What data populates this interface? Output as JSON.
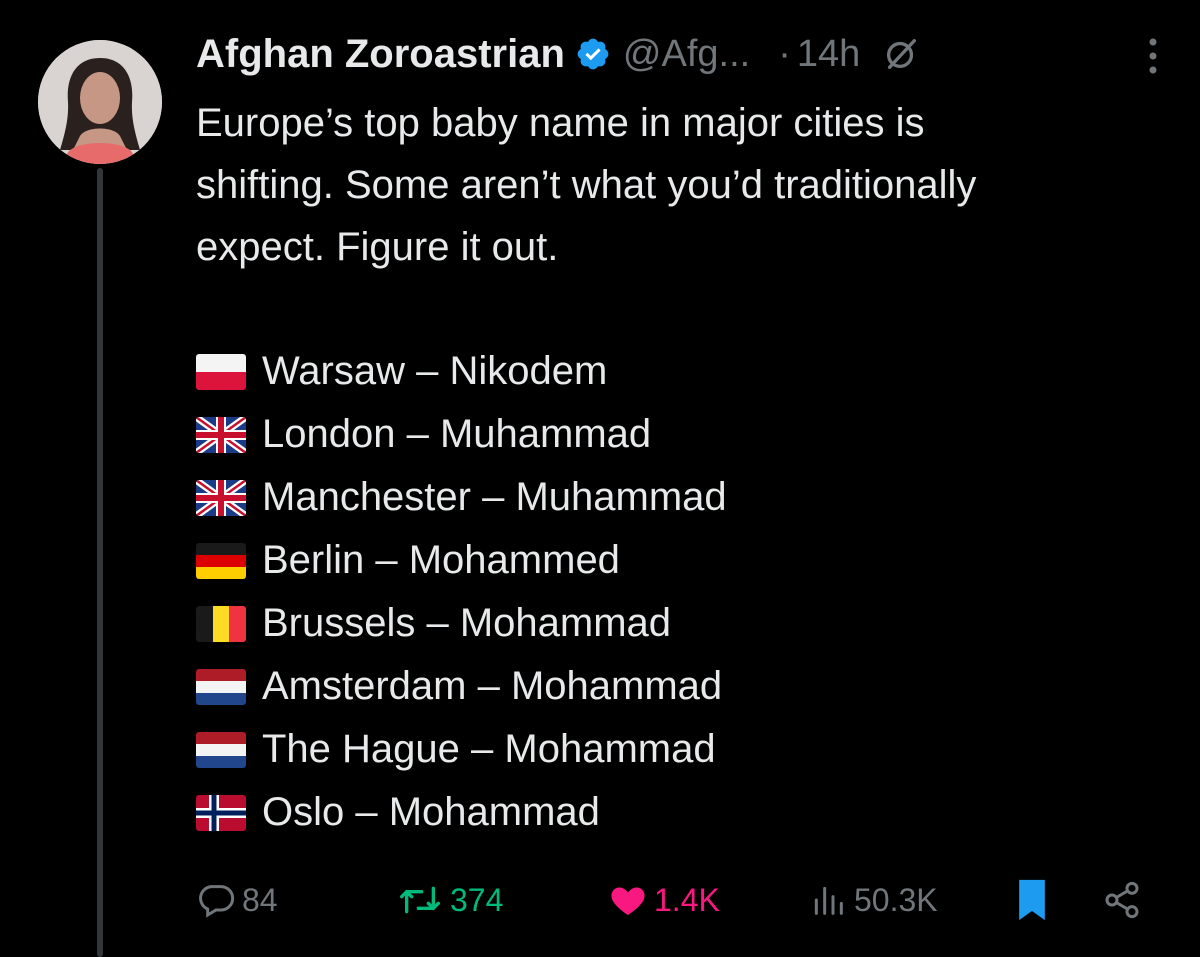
{
  "tweet": {
    "author_name": "Afghan Zoroastrian",
    "handle": "@Afg...",
    "separator": "·",
    "time": "14h",
    "text_lines": [
      "Europe’s top baby name in major cities is",
      "shifting. Some aren’t what you’d traditionally",
      "expect. Figure it out."
    ],
    "list": [
      {
        "flag": "poland-flag",
        "text": "Warsaw – Nikodem"
      },
      {
        "flag": "uk-flag",
        "text": "London – Muhammad"
      },
      {
        "flag": "uk-flag",
        "text": "Manchester – Muhammad"
      },
      {
        "flag": "germany-flag",
        "text": "Berlin – Mohammed"
      },
      {
        "flag": "belgium-flag",
        "text": "Brussels – Mohammad"
      },
      {
        "flag": "netherlands-flag",
        "text": "Amsterdam – Mohammad"
      },
      {
        "flag": "netherlands-flag",
        "text": "The Hague – Mohammad"
      },
      {
        "flag": "norway-flag",
        "text": "Oslo – Mohammad"
      }
    ],
    "stats": {
      "replies": "84",
      "retweets": "374",
      "likes": "1.4K",
      "views": "50.3K"
    }
  },
  "colors": {
    "background": "#000000",
    "text": "#e7e9ea",
    "muted": "#71767b",
    "verified": "#1d9bf0",
    "retweet": "#00ba7c",
    "like": "#f91880",
    "bookmark": "#1d9bf0"
  }
}
